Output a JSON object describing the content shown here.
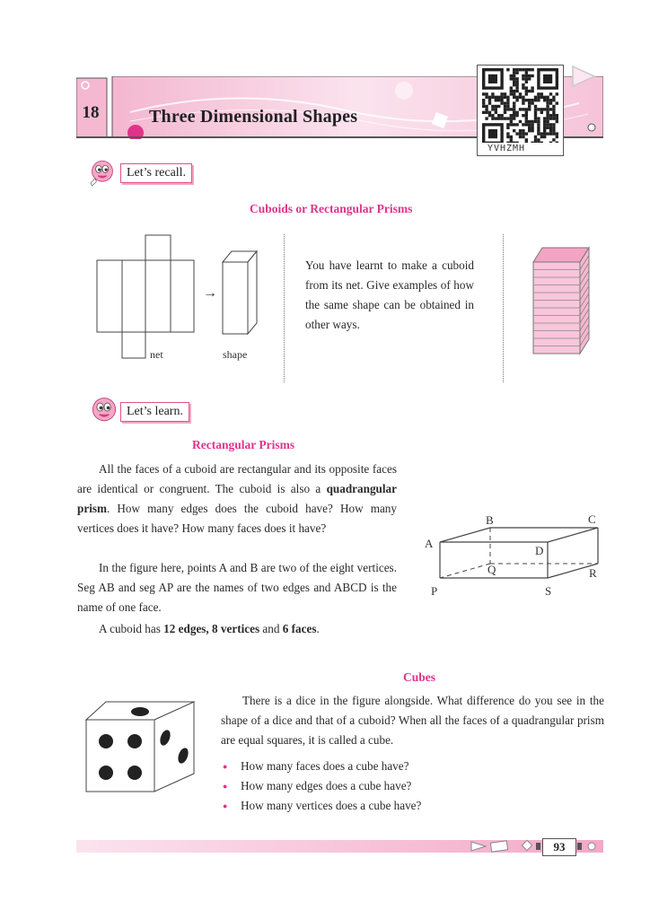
{
  "header": {
    "chapter_number": "18",
    "chapter_title": "Three Dimensional Shapes",
    "qr_code_label": "YVHZMH"
  },
  "recall": {
    "label": "Let’s recall.",
    "heading": "Cuboids or Rectangular Prisms",
    "net_label": "net",
    "shape_label": "shape",
    "arrow": "→",
    "text": "You have learnt to make a cuboid from its net. Give examples of how the same shape can be obtained in other ways."
  },
  "learn": {
    "label": "Let’s learn.",
    "heading": "Rectangular Prisms",
    "para1_a": "All the faces of a cuboid are rectangular and its opposite faces are identical or congruent. The cuboid  is also a ",
    "para1_bold": "quadrangular prism",
    "para1_b": ". How many edges does the cuboid have? How many vertices does it have? How many faces does it have?",
    "para2": "In the figure here, points A and B are two of the eight vertices. Seg AB and seg AP are the names of two edges and ABCD is the name of one face.",
    "para3_a": "A cuboid has ",
    "para3_b1": "12 edges, 8 vertices",
    "para3_c": " and ",
    "para3_b2": "6 faces",
    "para3_d": ".",
    "vertex_labels": [
      "A",
      "B",
      "C",
      "D",
      "P",
      "Q",
      "R",
      "S"
    ]
  },
  "cubes": {
    "heading": "Cubes",
    "para": "There is a dice in the figure alongside. What difference do you see in the shape of a dice and that of a cuboid? When all the faces of a quadrangular prism are equal squares, it is called a cube.",
    "questions": [
      "How many faces does a cube have?",
      "How many edges does a cube have?",
      "How many vertices does a cube have?"
    ]
  },
  "footer": {
    "page_number": "93"
  },
  "colors": {
    "accent_pink": "#e0338a",
    "banner_pink": "#f7c6da"
  }
}
